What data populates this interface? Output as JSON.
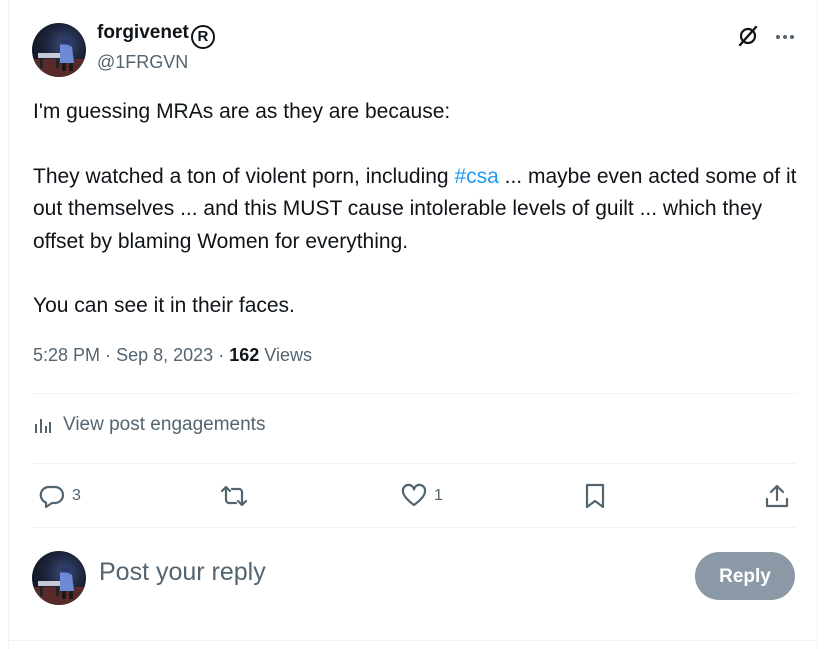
{
  "author": {
    "display_name": "forgivenet",
    "registered_mark": "R",
    "handle": "@1FRGVN",
    "avatar_icon": "avatar-piano-player-icon"
  },
  "header_actions": {
    "grok_icon": "grok-slash-icon",
    "more_icon": "more-dots-icon"
  },
  "post": {
    "line1": "I'm guessing MRAs are as they are because:",
    "para2_before": "They watched a ton of violent porn, including ",
    "hashtag": "#csa",
    "para2_after": " ... maybe even acted some of it out themselves ... and this MUST cause intolerable levels of guilt ... which they offset by blaming Women for everything.",
    "line3": "You can see it in their faces."
  },
  "meta": {
    "time": "5:28 PM",
    "date": "Sep 8, 2023",
    "views_count": "162",
    "views_label": "Views"
  },
  "engagements": {
    "label": "View post engagements",
    "icon": "analytics-icon"
  },
  "actions": {
    "reply_count": "3",
    "repost_count": "",
    "like_count": "1"
  },
  "compose": {
    "placeholder": "Post your reply",
    "button_label": "Reply"
  },
  "colors": {
    "accent": "#1d9bf0",
    "secondary_text": "#536471",
    "primary_text": "#0f1419",
    "reply_button_disabled": "#8b98a5",
    "divider": "#eff3f4"
  }
}
